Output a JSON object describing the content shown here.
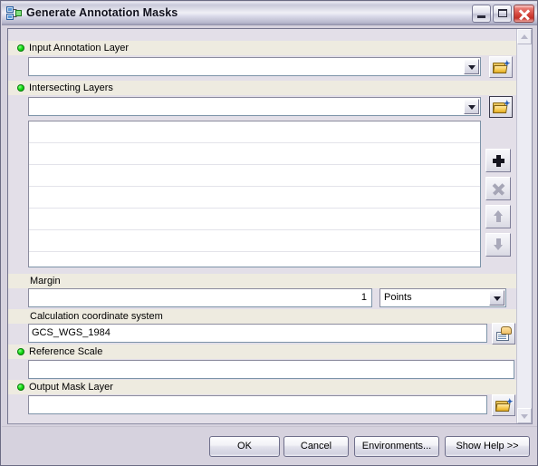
{
  "window": {
    "title": "Generate Annotation Masks",
    "icon": "geoprocessing-tool-icon",
    "controls": {
      "minimize": "Minimize",
      "maximize": "Maximize",
      "close": "Close"
    }
  },
  "form": {
    "fields": [
      {
        "id": "input-annotation-layer",
        "label": "Input Annotation Layer",
        "required": true,
        "control": "combobox",
        "value": "",
        "browse_icon": "folder-open-icon"
      },
      {
        "id": "intersecting-layers",
        "label": "Intersecting Layers",
        "required": true,
        "control": "combobox",
        "value": "",
        "browse_icon": "folder-open-icon"
      },
      {
        "id": "margin",
        "label": "Margin",
        "required": false,
        "control": "textbox",
        "value": "1",
        "units_value": "Points"
      },
      {
        "id": "calculation-coordinate-system",
        "label": "Calculation coordinate system",
        "required": false,
        "control": "textbox",
        "value": "GCS_WGS_1984",
        "browse_icon": "spatial-reference-icon"
      },
      {
        "id": "reference-scale",
        "label": "Reference Scale",
        "required": true,
        "control": "textbox",
        "value": ""
      },
      {
        "id": "output-mask-layer",
        "label": "Output Mask Layer",
        "required": true,
        "control": "textbox",
        "value": "",
        "browse_icon": "folder-open-icon"
      }
    ],
    "layer_list": {
      "name": "intersecting-layers-list",
      "items": [],
      "empty_row_count": 7
    },
    "list_tools": [
      {
        "id": "add",
        "icon": "plus-icon",
        "enabled": true
      },
      {
        "id": "remove",
        "icon": "close-x-icon",
        "enabled": false
      },
      {
        "id": "up",
        "icon": "arrow-up-icon",
        "enabled": false
      },
      {
        "id": "down",
        "icon": "arrow-down-icon",
        "enabled": false
      }
    ]
  },
  "buttons": {
    "ok": "OK",
    "cancel": "Cancel",
    "environments": "Environments...",
    "show_help": "Show Help >>"
  },
  "scrollbar": {
    "up_icon": "chevron-up-icon",
    "down_icon": "chevron-down-icon"
  },
  "colors": {
    "label_row": "#eeebe0",
    "panel": "#e3dfe8",
    "dialog": "#d6d2de",
    "required_dot": "#19e019",
    "field_border": "#7c93a8"
  }
}
